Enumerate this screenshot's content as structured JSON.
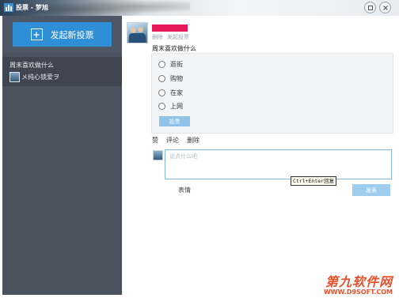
{
  "window": {
    "title": "投票 - 梦旭",
    "buttons": [
      "restore-icon",
      "close-icon"
    ]
  },
  "sidebar": {
    "new_vote_label": "发起新投票",
    "vote_list": [
      {
        "title": "周末喜欢做什么",
        "author": "メ纯心锁爱ヲ"
      }
    ]
  },
  "post": {
    "actions": [
      "删除",
      "发起投票"
    ],
    "question": "周末喜欢做什么",
    "options": [
      "逛街",
      "购物",
      "在家",
      "上网"
    ],
    "vote_button": "投票",
    "links": {
      "like": "赞",
      "comment": "评论",
      "delete": "删除"
    }
  },
  "comment": {
    "placeholder": "说点什么吧",
    "tooltip": "Ctrl+Enter回复",
    "emoji_label": "表情",
    "send_label": "发表"
  },
  "watermark": {
    "title": "第九软件网",
    "url": "WWW.D9SOFT.COM"
  },
  "colors": {
    "accent": "#2f8fd6",
    "sidebar_bg": "#4a525e",
    "redaction": "#e51858"
  }
}
